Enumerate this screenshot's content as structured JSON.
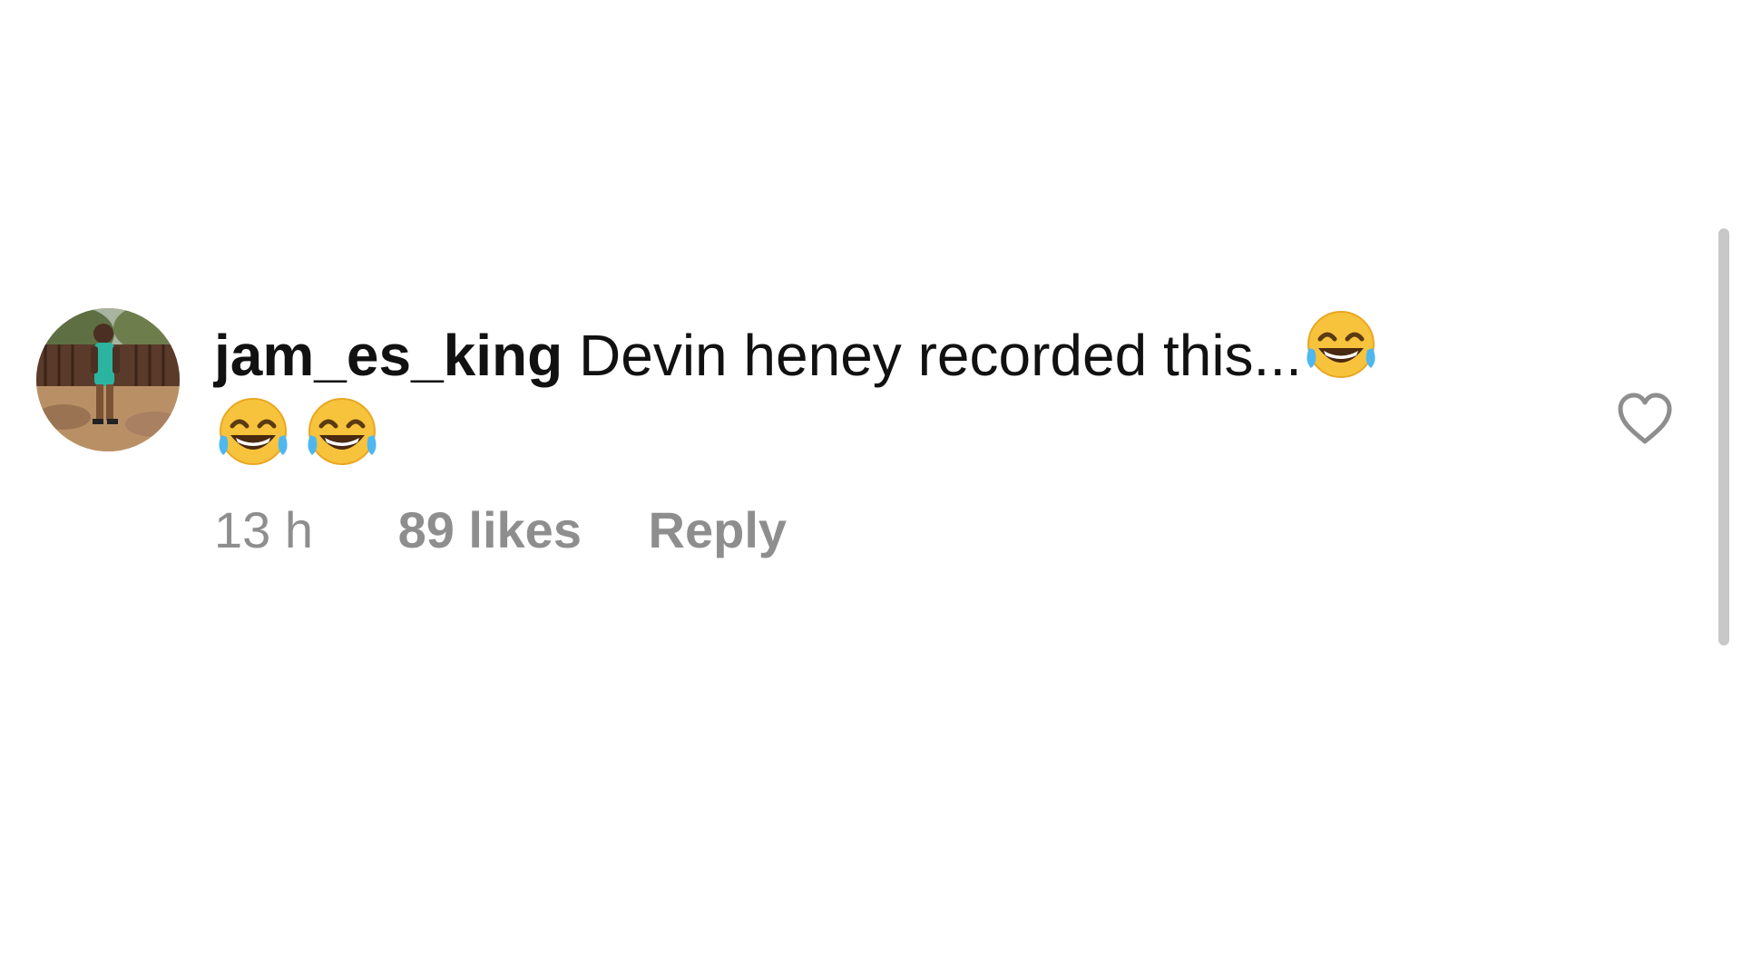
{
  "comment": {
    "username": "jam_es_king",
    "text": "Devin heney recorded this...",
    "emoji_icon": "face-with-tears-of-joy-icon",
    "time": "13 h",
    "likes": "89 likes",
    "reply_label": "Reply"
  },
  "colors": {
    "text": "#111111",
    "meta": "#8e8e8e",
    "scrollbar": "#c8c8c8"
  },
  "icons": {
    "like": "heart-outline-icon",
    "avatar": "user-avatar-photo"
  }
}
